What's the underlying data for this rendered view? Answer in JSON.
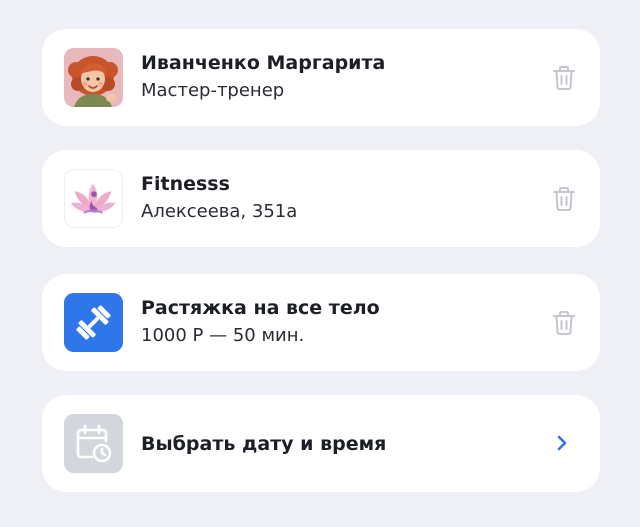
{
  "items": [
    {
      "title": "Иванченко Маргарита",
      "subtitle": "Мастер-тренер",
      "thumb_icon": "trainer-avatar",
      "action_icon": "trash-icon"
    },
    {
      "title": "Fitnesss",
      "subtitle": "Алексеева, 351а",
      "thumb_icon": "lotus-logo",
      "action_icon": "trash-icon"
    },
    {
      "title": "Растяжка на все тело",
      "subtitle": "1000 Р — 50 мин.",
      "thumb_icon": "dumbbell-icon",
      "action_icon": "trash-icon"
    },
    {
      "title": "Выбрать дату и время",
      "thumb_icon": "calendar-clock-icon",
      "action_icon": "chevron-right-icon"
    }
  ],
  "colors": {
    "background": "#eef0f5",
    "card": "#ffffff",
    "accent_blue": "#2e76ea",
    "trash_grey": "#c4c7ce",
    "chevron_blue": "#2e76ea"
  }
}
